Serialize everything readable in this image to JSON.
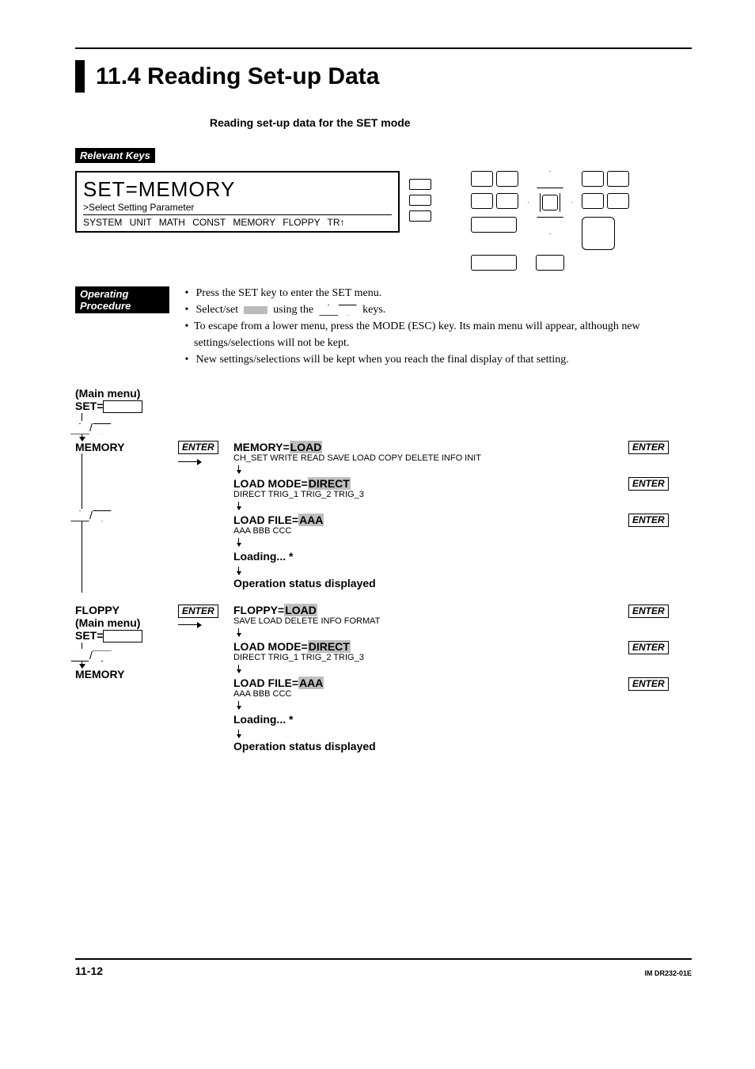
{
  "heading": "11.4 Reading Set-up Data",
  "subheading": "Reading set-up data for the SET mode",
  "labels": {
    "relevant_keys": "Relevant Keys",
    "operating_procedure": "Operating Procedure"
  },
  "lcd": {
    "line1": "SET=MEMORY",
    "line2": ">Select Setting Parameter",
    "line3": "SYSTEM  UNIT  MATH  CONST  MEMORY  FLOPPY  TR↑"
  },
  "procedure": [
    "Press the SET key to enter the SET menu.",
    "Select/set",
    "using the",
    "keys.",
    "To escape from a lower menu, press the MODE (ESC) key.  Its main menu will appear, although new settings/selections will not be kept.",
    "New settings/selections will be kept when you reach the final display of that setting."
  ],
  "enter_label": "ENTER",
  "flow": {
    "main_menu": "(Main menu)",
    "set_eq": "SET=",
    "memory": "MEMORY",
    "floppy": "FLOPPY",
    "memory_branch": {
      "line1_prefix": "MEMORY=",
      "line1_value": "LOAD",
      "line1_opts": "CH_SET WRITE READ SAVE LOAD COPY DELETE INFO INIT",
      "line2_prefix": "LOAD MODE=",
      "line2_value": "DIRECT",
      "line2_opts": "DIRECT TRIG_1 TRIG_2 TRIG_3",
      "line3_prefix": "LOAD FILE=",
      "line3_value": "AAA",
      "line3_opts": "AAA  BBB  CCC",
      "loading": "Loading...  *",
      "status": "Operation status displayed"
    },
    "floppy_branch": {
      "line1_prefix": "FLOPPY=",
      "line1_value": "LOAD",
      "line1_opts": "SAVE LOAD DELETE INFO FORMAT",
      "line2_prefix": "LOAD MODE=",
      "line2_value": "DIRECT",
      "line2_opts": "DIRECT TRIG_1 TRIG_2 TRIG_3",
      "line3_prefix": "LOAD FILE=",
      "line3_value": "AAA",
      "line3_opts": "AAA  BBB  CCC",
      "loading": "Loading...  *",
      "status": "Operation status displayed"
    }
  },
  "footer": {
    "page": "11-12",
    "docid": "IM DR232-01E"
  }
}
